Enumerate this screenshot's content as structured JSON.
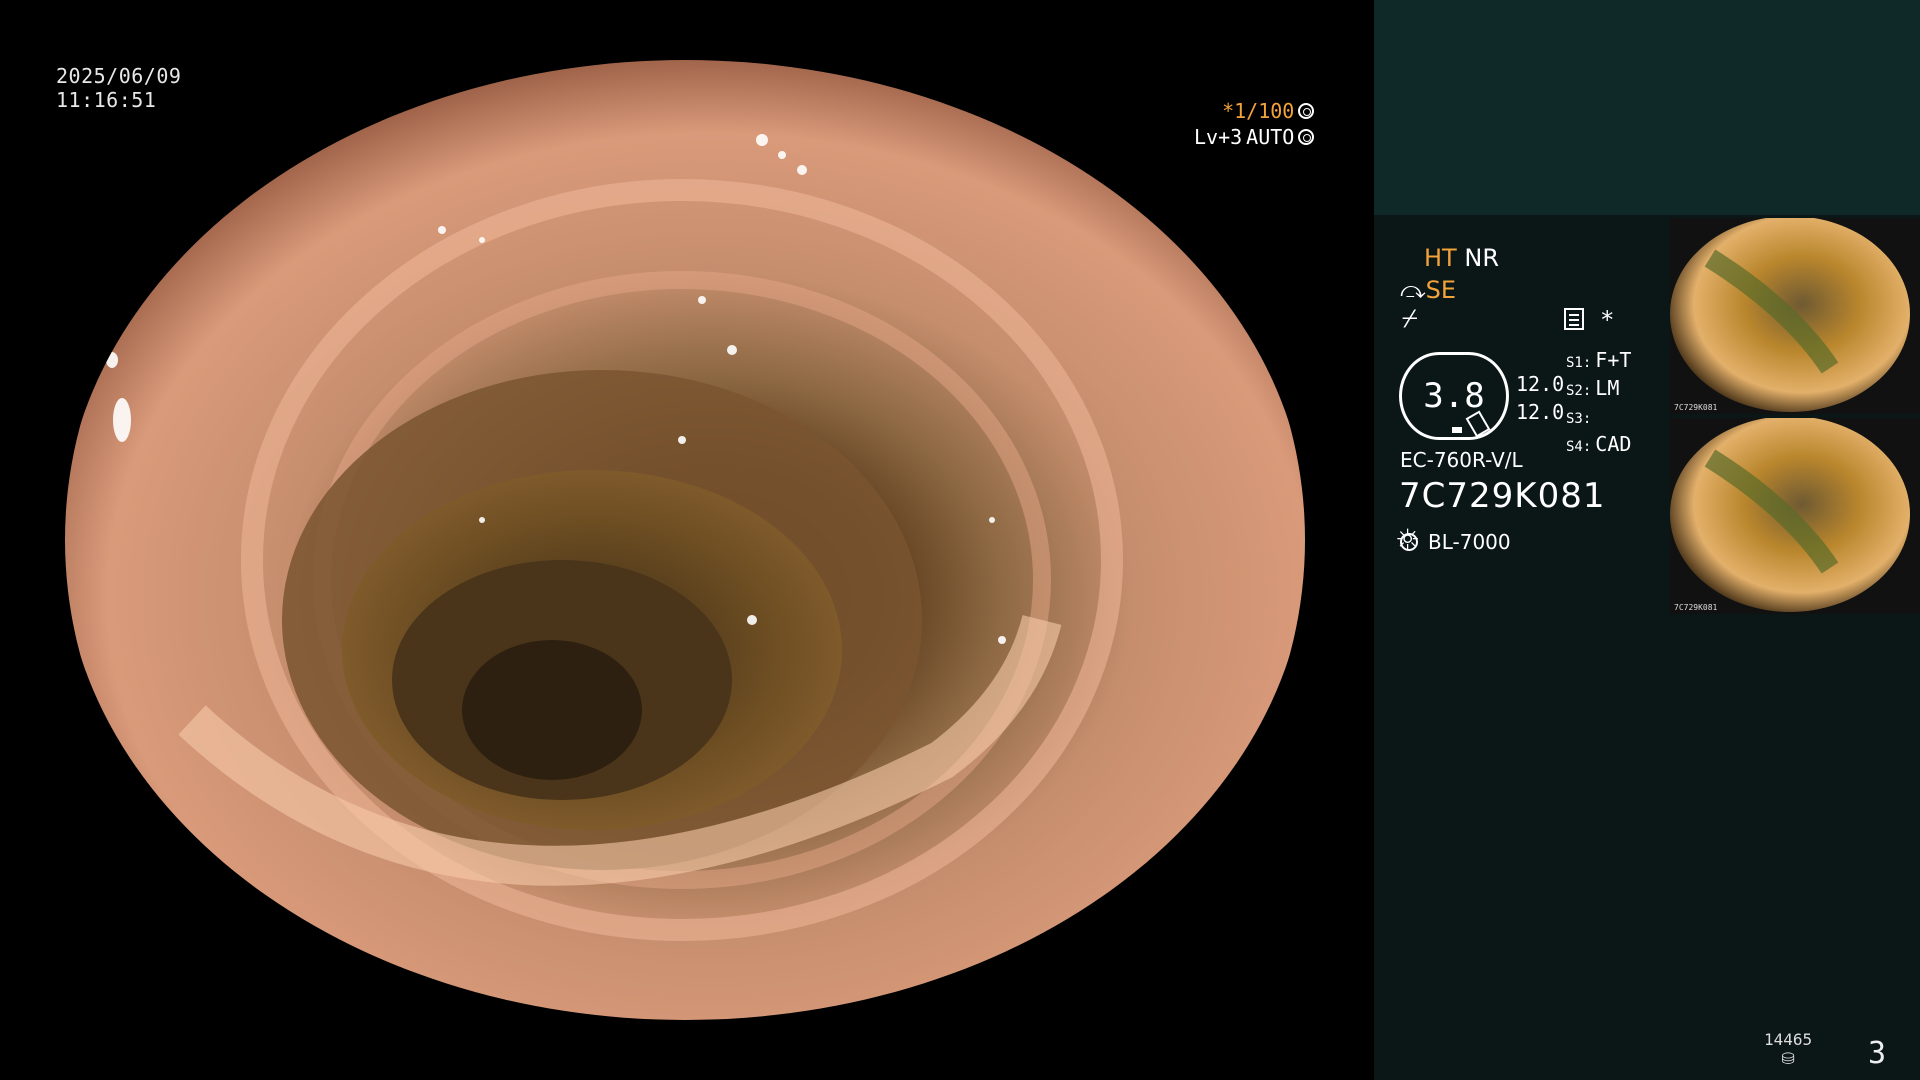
{
  "overlay": {
    "date": "2025/06/09",
    "time": "11:16:51",
    "shutter": "*1/100",
    "level": "Lv+3",
    "mode": "AUTO"
  },
  "panel": {
    "ht": "HT",
    "nr": "NR",
    "se": "SE",
    "zoom": "3.8",
    "value_1": "12.0",
    "value_2": "12.0",
    "s1_key": "S1:",
    "s1_val": "F+T",
    "s2_key": "S2:",
    "s2_val": "LM",
    "s3_key": "S3:",
    "s3_val": "",
    "s4_key": "S4:",
    "s4_val": "CAD",
    "scope_model": "EC-760R-V/L",
    "scope_serial": "7C729K081",
    "light_source": "BL-7000",
    "star": "*"
  },
  "thumbnails": [
    {
      "label": "7C729K081"
    },
    {
      "label": "7C729K081"
    }
  ],
  "footer": {
    "storage_count": "14465",
    "page_number": "3"
  },
  "icons": [
    "gear-icon",
    "settings-icon",
    "light-source-icon",
    "storage-icon"
  ],
  "colors": {
    "accent": "#f2a33a",
    "panel_bg": "#0b1617",
    "panel_top": "#0f2828"
  }
}
